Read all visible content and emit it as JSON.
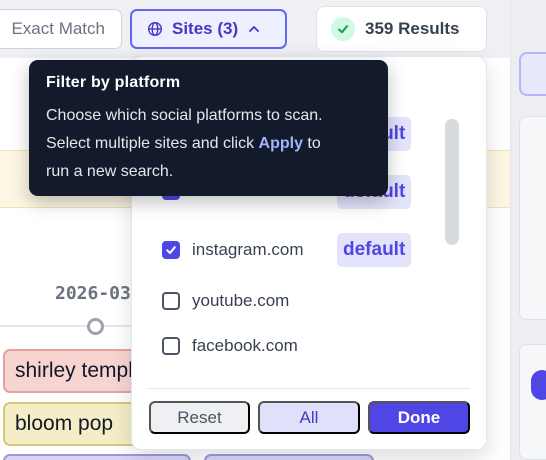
{
  "toolbar": {
    "exact_match_label": "Exact Match",
    "sites_label": "Sites (3)",
    "results_label": "359 Results"
  },
  "timeline": {
    "date_label": "2026-03"
  },
  "tags": [
    "shirley temple",
    "bloom pop"
  ],
  "dropdown": {
    "sites": [
      {
        "name": "",
        "checked": true,
        "badge": "default"
      },
      {
        "name": "",
        "checked": true,
        "badge": "default"
      },
      {
        "name": "instagram.com",
        "checked": true,
        "badge": "default"
      },
      {
        "name": "youtube.com",
        "checked": false,
        "badge": ""
      },
      {
        "name": "facebook.com",
        "checked": false,
        "badge": ""
      }
    ],
    "reset_label": "Reset",
    "all_label": "All",
    "done_label": "Done"
  },
  "tooltip": {
    "title": "Filter by platform",
    "line1": "Choose which social platforms to scan.",
    "line2_before": "Select multiple sites and click ",
    "line2_link": "Apply",
    "line2_after": " to",
    "line3": "run a new search."
  },
  "colors": {
    "accent": "#4f46e5",
    "tooltip_bg": "#121a2b",
    "success": "#16a34a"
  }
}
